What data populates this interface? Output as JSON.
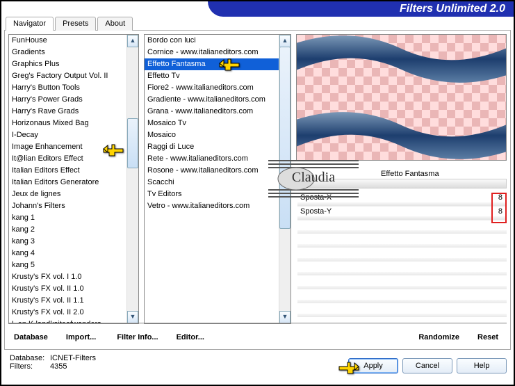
{
  "app_title": "Filters Unlimited 2.0",
  "tabs": {
    "navigator": "Navigator",
    "presets": "Presets",
    "about": "About"
  },
  "left_list": [
    "FunHouse",
    "Gradients",
    "Graphics Plus",
    "Greg's Factory Output Vol. II",
    "Harry's Button Tools",
    "Harry's Power Grads",
    "Harry's Rave Grads",
    "Horizonaus Mixed Bag",
    "I-Decay",
    "Image Enhancement",
    "It@lian Editors Effect",
    "Italian Editors Effect",
    "Italian Editors Generatore",
    "Jeux de lignes",
    "Johann's Filters",
    "kang 1",
    "kang 2",
    "kang 3",
    "kang 4",
    "kang 5",
    "Krusty's FX vol. I 1.0",
    "Krusty's FX vol. II 1.0",
    "Krusty's FX vol. II 1.1",
    "Krusty's FX vol. II 2.0",
    "L en K landksiteofwonders"
  ],
  "left_selected_index": 10,
  "mid_list": [
    "Bordo con luci",
    "Cornice - www.italianeditors.com",
    "Effetto Fantasma",
    "Effetto Tv",
    "Fiore2 - www.italianeditors.com",
    "Gradiente - www.italianeditors.com",
    "Grana - www.italianeditors.com",
    "Mosaico Tv",
    "Mosaico",
    "Raggi di Luce",
    "Rete - www.italianeditors.com",
    "Rosone - www.italianeditors.com",
    "Scacchi",
    "Tv Editors",
    "Vetro - www.italianeditors.com"
  ],
  "mid_selected_index": 2,
  "effect_name": "Effetto Fantasma",
  "params": [
    {
      "label": "Sposta-X",
      "value": "8"
    },
    {
      "label": "Sposta-Y",
      "value": "8"
    }
  ],
  "bottom_row": {
    "database": "Database",
    "import": "Import...",
    "filter_info": "Filter Info...",
    "editor": "Editor...",
    "randomize": "Randomize",
    "reset": "Reset"
  },
  "status": {
    "db_label": "Database:",
    "db_value": "ICNET-Filters",
    "filters_label": "Filters:",
    "filters_value": "4355"
  },
  "buttons": {
    "apply": "Apply",
    "cancel": "Cancel",
    "help": "Help"
  },
  "watermark_text": "Claudia"
}
